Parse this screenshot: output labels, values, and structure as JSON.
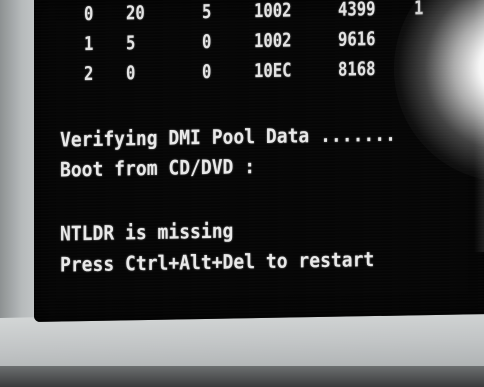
{
  "pci_table": {
    "rows": [
      {
        "c0": "0",
        "c1": "20",
        "c2": "5",
        "c3": "1002",
        "c4": "4399",
        "c5": "1"
      },
      {
        "c0": "1",
        "c1": "5",
        "c2": "0",
        "c3": "1002",
        "c4": "9616",
        "c5": ""
      },
      {
        "c0": "2",
        "c1": "0",
        "c2": "0",
        "c3": "10EC",
        "c4": "8168",
        "c5": ""
      }
    ]
  },
  "messages": {
    "verify": "Verifying DMI Pool Data .......",
    "boot": "Boot from CD/DVD :",
    "error": "NTLDR is missing",
    "restart": "Press Ctrl+Alt+Del to restart"
  }
}
